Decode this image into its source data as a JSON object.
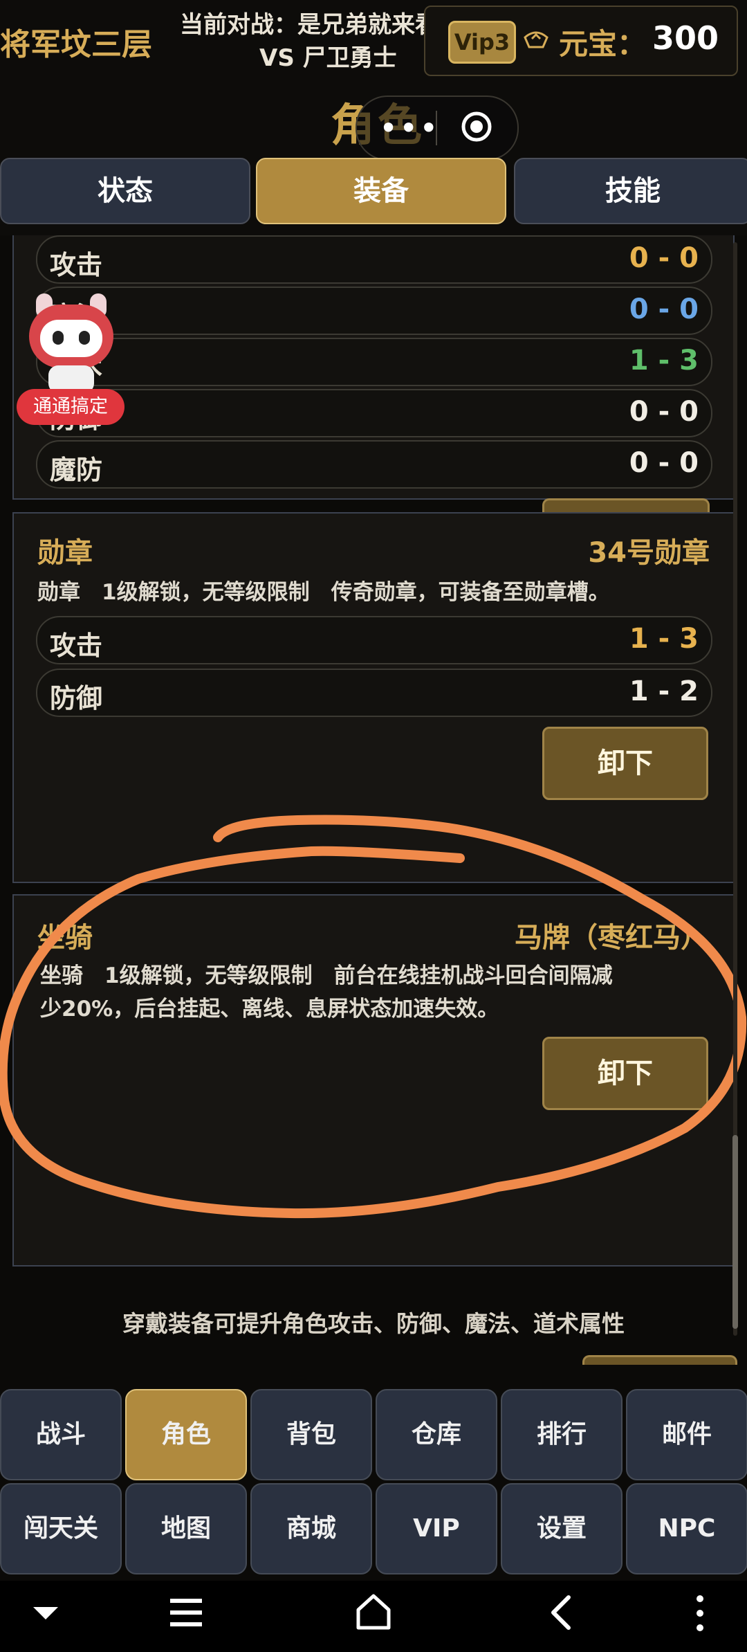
{
  "header": {
    "location": "将军坟三层",
    "battle_line1": "当前对战：是兄弟就来看我",
    "battle_line2": "VS 尸卫勇士",
    "vip": "Vip3",
    "currency_label": "元宝：",
    "currency_value": "300",
    "title": "角色",
    "capsule_dots": "•••"
  },
  "tabs": [
    {
      "label": "状态",
      "active": false
    },
    {
      "label": "装备",
      "active": true
    },
    {
      "label": "技能",
      "active": false
    }
  ],
  "top_stats": [
    {
      "label": "攻击",
      "value": "0 - 0",
      "color": "#e7b24e"
    },
    {
      "label": "魔法",
      "value": "0 - 0",
      "color": "#6aa6e6"
    },
    {
      "label": "道术",
      "value": "1 - 3",
      "color": "#5fbf6a"
    },
    {
      "label": "防御",
      "value": "0 - 0",
      "color": "#f1ede4"
    },
    {
      "label": "魔防",
      "value": "0 - 0",
      "color": "#f1ede4"
    }
  ],
  "medal": {
    "title": "勋章",
    "name": "34号勋章",
    "desc": "勋章　1级解锁，无等级限制　传奇勋章，可装备至勋章槽。",
    "stats": [
      {
        "label": "攻击",
        "value": "1 - 3",
        "color": "#e7b24e"
      },
      {
        "label": "防御",
        "value": "1 - 2",
        "color": "#f1ede4"
      }
    ],
    "button": "卸下"
  },
  "mount": {
    "title": "坐骑",
    "name": "马牌（枣红马）",
    "desc_line1": "坐骑　1级解锁，无等级限制　前台在线挂机战斗回合间隔减",
    "desc_line2": "少20%，后台挂起、离线、息屏状态加速失效。",
    "button": "卸下"
  },
  "hint": "穿戴装备可提升角色攻击、防御、魔法、道术属性",
  "mascot_label": "通通搞定",
  "nav": [
    {
      "label": "战斗",
      "active": false
    },
    {
      "label": "角色",
      "active": true
    },
    {
      "label": "背包",
      "active": false
    },
    {
      "label": "仓库",
      "active": false
    },
    {
      "label": "排行",
      "active": false
    },
    {
      "label": "邮件",
      "active": false
    },
    {
      "label": "闯天关",
      "active": false
    },
    {
      "label": "地图",
      "active": false
    },
    {
      "label": "商城",
      "active": false
    },
    {
      "label": "VIP",
      "active": false
    },
    {
      "label": "设置",
      "active": false
    },
    {
      "label": "NPC",
      "active": false
    }
  ],
  "colors": {
    "accent": "#b08a3e",
    "gold_text": "#d7ad58",
    "annotation": "#f08a4b"
  }
}
